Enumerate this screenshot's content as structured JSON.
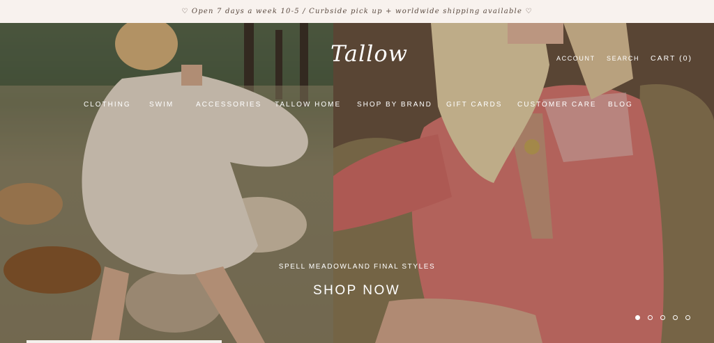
{
  "announcement": "♡ Open 7 days a week 10-5 / Curbside pick up + worldwide shipping available ♡",
  "header": {
    "logo": "Tallow",
    "account_label": "ACCOUNT",
    "search_label": "SEARCH",
    "cart_label": "CART (0)"
  },
  "nav": {
    "items": [
      "CLOTHING",
      "SWIM",
      "ACCESSORIES",
      "TALLOW HOME",
      "SHOP BY BRAND",
      "GIFT CARDS",
      "CUSTOMER CARE",
      "BLOG"
    ]
  },
  "hero": {
    "tagline": "SPELL MEADOWLAND FINAL STYLES",
    "cta_label": "SHOP NOW",
    "slide_count": 5,
    "active_slide": 1
  },
  "colors": {
    "announcement_bg": "#f8f2ee",
    "announcement_text": "#5a4a40",
    "overlay_text": "#ffffff",
    "dress_left": "#e9dccb",
    "dress_right": "#d9786f"
  }
}
